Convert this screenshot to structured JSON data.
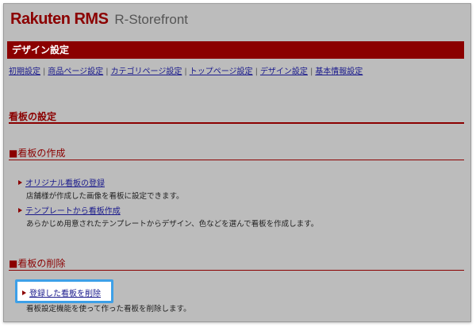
{
  "header": {
    "brand": "Rakuten RMS",
    "product": "R-Storefront"
  },
  "title_bar": {
    "label": "デザイン設定"
  },
  "nav": {
    "items": [
      "初期設定",
      "商品ページ設定",
      "カテゴリページ設定",
      "トップページ設定",
      "デザイン設定",
      "基本情報設定"
    ],
    "separator": "|"
  },
  "main": {
    "title": "看板の設定",
    "create_section": {
      "title": "■看板の作成",
      "items": [
        {
          "link": "オリジナル看板の登録",
          "desc": "店舗様が作成した画像を看板に設定できます。"
        },
        {
          "link": "テンプレートから看板作成",
          "desc": "あらかじめ用意されたテンプレートからデザイン、色などを選んで看板を作成します。"
        }
      ]
    },
    "delete_section": {
      "title": "■看板の削除",
      "items": [
        {
          "link": "登録した看板を削除",
          "desc": "看板設定機能を使って作った看板を削除します。"
        }
      ]
    }
  },
  "colors": {
    "accent": "#8b0000",
    "link": "#1a1a8c",
    "highlight": "#3da0e8",
    "background": "#bcbcbc"
  }
}
